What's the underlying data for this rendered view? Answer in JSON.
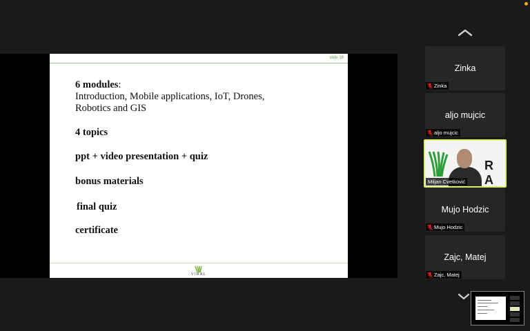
{
  "slide": {
    "number_label": "slide 18",
    "modules_bold": "6 modules",
    "modules_colon": ":",
    "modules_line2": "Introduction, Mobile applications, IoT, Drones,",
    "modules_line3": "Robotics and GIS",
    "topics": "4 topics",
    "presentation": "ppt + video presentation + quiz",
    "bonus": "bonus materials",
    "final_quiz": "final quiz",
    "certificate": "certificate",
    "logo_text": "VIRAL"
  },
  "participants": [
    {
      "name": "Zinka",
      "tag": "Zinka",
      "muted": true
    },
    {
      "name": "aljo mujcic",
      "tag": "aljo mujcic",
      "muted": true
    },
    {
      "name": "Miljan Cvetković",
      "tag": "Miljan Cvetković",
      "muted": false,
      "active_speaker": true,
      "background_text": "R A"
    },
    {
      "name": "Mujo Hodzic",
      "tag": "Mujo Hodzic",
      "muted": true
    },
    {
      "name": "Zajc, Matej",
      "tag": "Zajc, Matej",
      "muted": true
    }
  ],
  "colors": {
    "active_border": "#d7ef6a",
    "mic_muted": "#e02020",
    "slide_accent": "#9cc77e"
  },
  "icons": {
    "scroll_up": "chevron-up-icon",
    "scroll_down": "chevron-down-icon",
    "muted_mic": "mic-muted-icon"
  }
}
